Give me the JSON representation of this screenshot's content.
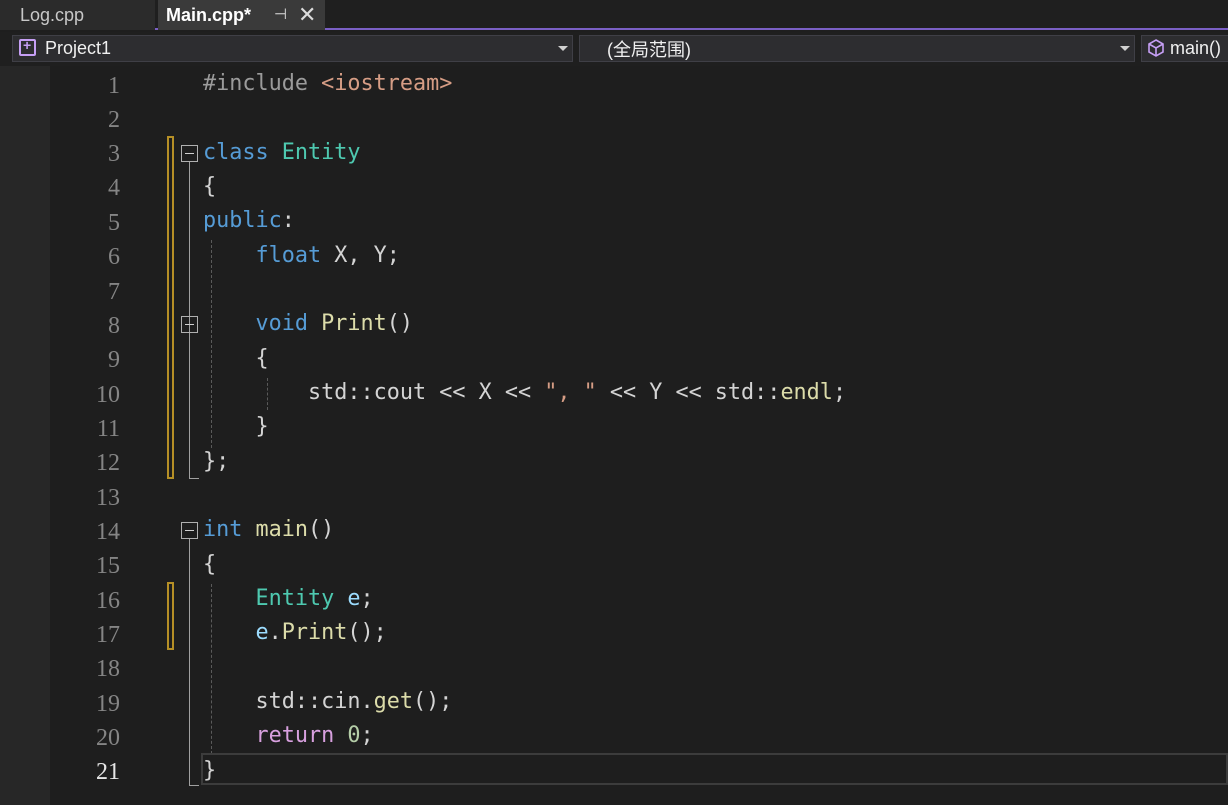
{
  "tabs": [
    {
      "label": "Log.cpp",
      "active": false
    },
    {
      "label": "Main.cpp*",
      "active": true,
      "pin_glyph": "⊣",
      "close_glyph": "✕"
    }
  ],
  "navbar": {
    "project": "Project1",
    "scope": "(全局范围)",
    "member": "main()"
  },
  "colors": {
    "accent": "#7a5fc4",
    "keyword": "#569cd6",
    "type": "#4ec9b0",
    "function": "#dcdcaa",
    "string": "#d69d85",
    "change_marker": "#c8a42d"
  },
  "current_line": 21,
  "code_lines": [
    {
      "n": "1",
      "t": "#include <iostream>"
    },
    {
      "n": "2",
      "t": ""
    },
    {
      "n": "3",
      "t": "class Entity"
    },
    {
      "n": "4",
      "t": "{"
    },
    {
      "n": "5",
      "t": "public:"
    },
    {
      "n": "6",
      "t": "    float X, Y;"
    },
    {
      "n": "7",
      "t": ""
    },
    {
      "n": "8",
      "t": "    void Print()"
    },
    {
      "n": "9",
      "t": "    {"
    },
    {
      "n": "10",
      "t": "        std::cout << X << \", \" << Y << std::endl;"
    },
    {
      "n": "11",
      "t": "    }"
    },
    {
      "n": "12",
      "t": "};"
    },
    {
      "n": "13",
      "t": ""
    },
    {
      "n": "14",
      "t": "int main()"
    },
    {
      "n": "15",
      "t": "{"
    },
    {
      "n": "16",
      "t": "    Entity e;"
    },
    {
      "n": "17",
      "t": "    e.Print();"
    },
    {
      "n": "18",
      "t": ""
    },
    {
      "n": "19",
      "t": "    std::cin.get();"
    },
    {
      "n": "20",
      "t": "    return 0;"
    },
    {
      "n": "21",
      "t": "}"
    }
  ]
}
